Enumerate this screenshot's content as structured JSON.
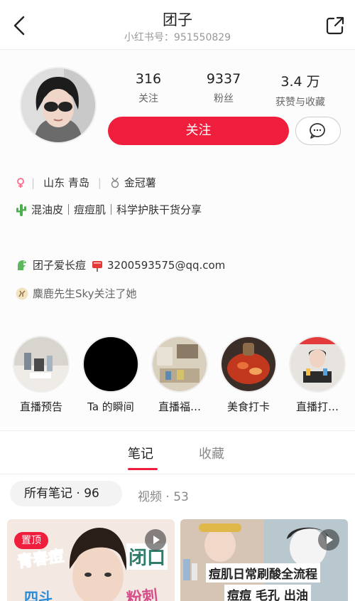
{
  "header": {
    "title": "团子",
    "subtitle": "小红书号：951550829"
  },
  "stats": [
    {
      "num": "316",
      "label": "关注"
    },
    {
      "num": "9337",
      "label": "粉丝"
    },
    {
      "num": "3.4 万",
      "label": "获赞与收藏"
    }
  ],
  "actions": {
    "follow_label": "关注"
  },
  "profile": {
    "location": "山东 青岛",
    "badge": "金冠薯",
    "bio": "混油皮｜痘痘肌｜科学护肤干货分享",
    "link_name": "团子爱长痘",
    "email": "3200593575@qq.com",
    "followed_by": "麋鹿先生Sky关注了她"
  },
  "stories": [
    {
      "label": "直播预告"
    },
    {
      "label": "Ta 的瞬间"
    },
    {
      "label": "直播福…"
    },
    {
      "label": "美食打卡"
    },
    {
      "label": "直播打…"
    }
  ],
  "tabs": {
    "notes": "笔记",
    "collections": "收藏"
  },
  "filters": {
    "all_notes": "所有笔记 · 96",
    "videos": "视频 · 53"
  },
  "notes": [
    {
      "pin": "置顶",
      "texts": [
        "青春痘",
        "闭口",
        "四斗",
        "粉刺"
      ]
    },
    {
      "texts": [
        "痘肌日常刷酸全流程",
        "痘痘 毛孔 出油"
      ]
    }
  ],
  "colors": {
    "accent": "#ee1e3c"
  }
}
